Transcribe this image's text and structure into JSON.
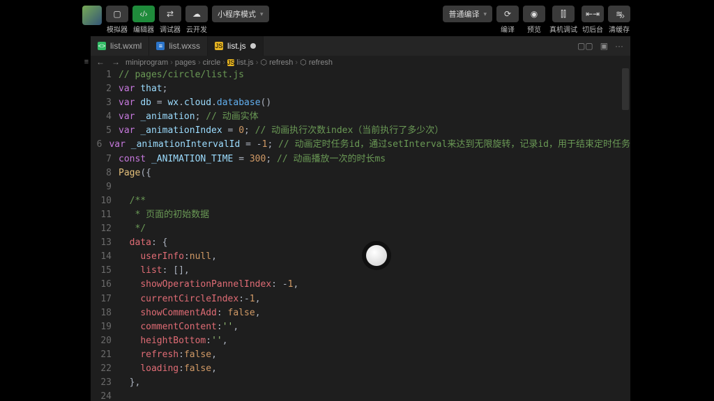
{
  "toolbar": {
    "items": [
      {
        "icon": "▢",
        "label": "模拟器",
        "green": false
      },
      {
        "icon": "‹/›",
        "label": "编辑器",
        "green": true
      },
      {
        "icon": "⇄",
        "label": "调试器",
        "green": false
      },
      {
        "icon": "☁",
        "label": "云开发",
        "green": false
      }
    ],
    "mode_label": "小程序模式",
    "compile_label": "普通编译",
    "right": [
      {
        "icon": "⟳",
        "label": "编译"
      },
      {
        "icon": "◉",
        "label": "预览"
      },
      {
        "icon": "⫿⫿",
        "label": "真机调试"
      },
      {
        "icon": "⇤⇥",
        "label": "切后台"
      },
      {
        "icon": "≋",
        "label": "清缓存"
      }
    ],
    "overflow": "»"
  },
  "tabs": [
    {
      "kind": "wxml",
      "icon": "<>",
      "name": "list.wxml",
      "active": false,
      "dirty": false
    },
    {
      "kind": "wxss",
      "icon": "≡",
      "name": "list.wxss",
      "active": false,
      "dirty": false
    },
    {
      "kind": "js",
      "icon": "JS",
      "name": "list.js",
      "active": true,
      "dirty": true
    }
  ],
  "tab_actions": {
    "split": "▢▢",
    "layout": "▣",
    "more": "···"
  },
  "breadcrumb": {
    "nav_back": "←",
    "nav_fwd": "→",
    "parts": [
      "miniprogram",
      "pages",
      "circle",
      "list.js",
      "refresh",
      "refresh"
    ],
    "file_icon": "JS",
    "sym_icon": "⬢"
  },
  "gutter_btn": "≡",
  "code": {
    "1": [
      [
        "cmt",
        "// pages/circle/list.js"
      ]
    ],
    "2": [
      [
        "kw",
        "var"
      ],
      [
        "plain",
        " "
      ],
      [
        "var",
        "that"
      ],
      [
        "punc",
        ";"
      ]
    ],
    "3": [
      [
        "kw",
        "var"
      ],
      [
        "plain",
        " "
      ],
      [
        "var",
        "db"
      ],
      [
        "plain",
        " "
      ],
      [
        "punc",
        "="
      ],
      [
        "plain",
        " "
      ],
      [
        "var",
        "wx"
      ],
      [
        "punc",
        "."
      ],
      [
        "var",
        "cloud"
      ],
      [
        "punc",
        "."
      ],
      [
        "fn",
        "database"
      ],
      [
        "punc",
        "()"
      ]
    ],
    "4": [
      [
        "kw",
        "var"
      ],
      [
        "plain",
        " "
      ],
      [
        "var",
        "_animation"
      ],
      [
        "punc",
        ";"
      ],
      [
        "plain",
        " "
      ],
      [
        "cmt",
        "// 动画实体"
      ]
    ],
    "5": [
      [
        "kw",
        "var"
      ],
      [
        "plain",
        " "
      ],
      [
        "var",
        "_animationIndex"
      ],
      [
        "plain",
        " "
      ],
      [
        "punc",
        "="
      ],
      [
        "plain",
        " "
      ],
      [
        "num",
        "0"
      ],
      [
        "punc",
        ";"
      ],
      [
        "plain",
        " "
      ],
      [
        "cmt",
        "// 动画执行次数index（当前执行了多少次）"
      ]
    ],
    "6": [
      [
        "kw",
        "var"
      ],
      [
        "plain",
        " "
      ],
      [
        "var",
        "_animationIntervalId"
      ],
      [
        "plain",
        " "
      ],
      [
        "punc",
        "="
      ],
      [
        "plain",
        " "
      ],
      [
        "punc",
        "-"
      ],
      [
        "num",
        "1"
      ],
      [
        "punc",
        ";"
      ],
      [
        "plain",
        " "
      ],
      [
        "cmt",
        "// 动画定时任务id，通过setInterval来达到无限旋转，记录id，用于结束定时任务"
      ]
    ],
    "7": [
      [
        "kw",
        "const"
      ],
      [
        "plain",
        " "
      ],
      [
        "var",
        "_ANIMATION_TIME"
      ],
      [
        "plain",
        " "
      ],
      [
        "punc",
        "="
      ],
      [
        "plain",
        " "
      ],
      [
        "num",
        "300"
      ],
      [
        "punc",
        ";"
      ],
      [
        "plain",
        " "
      ],
      [
        "cmt",
        "// 动画播放一次的时长ms"
      ]
    ],
    "8": [
      [
        "type",
        "Page"
      ],
      [
        "punc",
        "({"
      ]
    ],
    "9": [],
    "10": [
      [
        "plain",
        "  "
      ],
      [
        "cmt",
        "/**"
      ]
    ],
    "11": [
      [
        "plain",
        "   "
      ],
      [
        "cmt",
        "* 页面的初始数据"
      ]
    ],
    "12": [
      [
        "plain",
        "   "
      ],
      [
        "cmt",
        "*/"
      ]
    ],
    "13": [
      [
        "plain",
        "  "
      ],
      [
        "prop",
        "data"
      ],
      [
        "punc",
        ":"
      ],
      [
        "plain",
        " "
      ],
      [
        "punc",
        "{"
      ]
    ],
    "14": [
      [
        "plain",
        "    "
      ],
      [
        "prop",
        "userInfo"
      ],
      [
        "punc",
        ":"
      ],
      [
        "bool",
        "null"
      ],
      [
        "punc",
        ","
      ]
    ],
    "15": [
      [
        "plain",
        "    "
      ],
      [
        "prop",
        "list"
      ],
      [
        "punc",
        ":"
      ],
      [
        "plain",
        " "
      ],
      [
        "punc",
        "[],"
      ]
    ],
    "16": [
      [
        "plain",
        "    "
      ],
      [
        "prop",
        "showOperationPannelIndex"
      ],
      [
        "punc",
        ":"
      ],
      [
        "plain",
        " "
      ],
      [
        "punc",
        "-"
      ],
      [
        "num",
        "1"
      ],
      [
        "punc",
        ","
      ]
    ],
    "17": [
      [
        "plain",
        "    "
      ],
      [
        "prop",
        "currentCircleIndex"
      ],
      [
        "punc",
        ":"
      ],
      [
        "punc",
        "-"
      ],
      [
        "num",
        "1"
      ],
      [
        "punc",
        ","
      ]
    ],
    "18": [
      [
        "plain",
        "    "
      ],
      [
        "prop",
        "showCommentAdd"
      ],
      [
        "punc",
        ":"
      ],
      [
        "plain",
        " "
      ],
      [
        "bool",
        "false"
      ],
      [
        "punc",
        ","
      ]
    ],
    "19": [
      [
        "plain",
        "    "
      ],
      [
        "prop",
        "commentContent"
      ],
      [
        "punc",
        ":"
      ],
      [
        "str",
        "''"
      ],
      [
        "punc",
        ","
      ]
    ],
    "20": [
      [
        "plain",
        "    "
      ],
      [
        "prop",
        "heightBottom"
      ],
      [
        "punc",
        ":"
      ],
      [
        "str",
        "''"
      ],
      [
        "punc",
        ","
      ]
    ],
    "21": [
      [
        "plain",
        "    "
      ],
      [
        "prop",
        "refresh"
      ],
      [
        "punc",
        ":"
      ],
      [
        "bool",
        "false"
      ],
      [
        "punc",
        ","
      ]
    ],
    "22": [
      [
        "plain",
        "    "
      ],
      [
        "prop",
        "loading"
      ],
      [
        "punc",
        ":"
      ],
      [
        "bool",
        "false"
      ],
      [
        "punc",
        ","
      ]
    ],
    "23": [
      [
        "plain",
        "  "
      ],
      [
        "punc",
        "},"
      ]
    ],
    "24": []
  },
  "line_count": 24
}
